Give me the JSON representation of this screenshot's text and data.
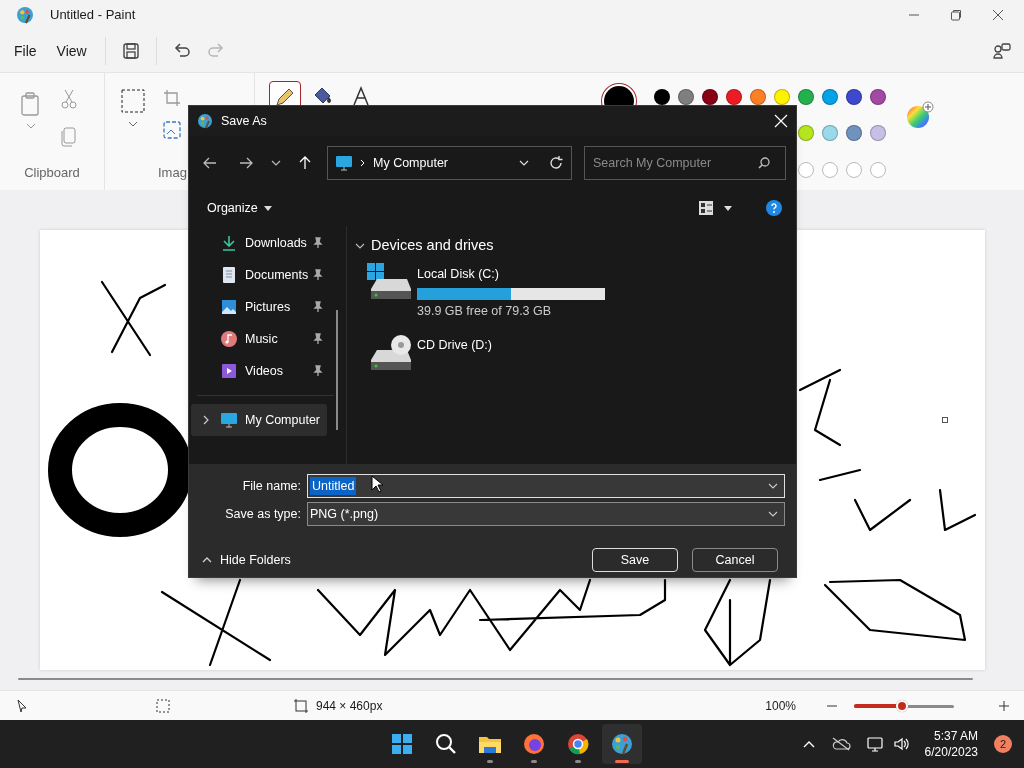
{
  "window": {
    "title": "Untitled - Paint"
  },
  "menu": [
    {
      "label": "File"
    },
    {
      "label": "View"
    }
  ],
  "quick_actions": [
    {
      "kind": "save",
      "disabled": false
    },
    {
      "kind": "undo",
      "disabled": false
    },
    {
      "kind": "redo",
      "disabled": true
    }
  ],
  "ribbon": {
    "groups": [
      {
        "label": "Clipboard"
      },
      {
        "label": "Imag"
      }
    ],
    "tools": [
      {
        "kind": "pencil",
        "selected": true
      },
      {
        "kind": "fill",
        "selected": false
      },
      {
        "kind": "text",
        "selected": false
      }
    ],
    "current_color": {
      "color": "#000000"
    },
    "palette_row_1": [
      {
        "color": "#000000"
      },
      {
        "color": "#7f7f7f"
      },
      {
        "color": "#880015"
      },
      {
        "color": "#ed1c24"
      },
      {
        "color": "#ff7f27"
      },
      {
        "color": "#fff200"
      },
      {
        "color": "#22b14c"
      },
      {
        "color": "#00a2e8"
      },
      {
        "color": "#3f48cc"
      },
      {
        "color": "#a349a4"
      }
    ],
    "palette_row_2": [
      {
        "color": "#b5e61d"
      },
      {
        "color": "#99d9ea"
      },
      {
        "color": "#7092be"
      },
      {
        "color": "#c8bfe7"
      }
    ]
  },
  "dialog": {
    "title": "Save As",
    "address": "My Computer",
    "search": {
      "placeholder": "Search My Computer"
    },
    "organize": "Organize",
    "nav_items": [
      {
        "label": "Downloads",
        "kind": "downloads",
        "pinned": true,
        "expandable": false,
        "selected": false
      },
      {
        "label": "Documents",
        "kind": "documents",
        "pinned": true,
        "expandable": false,
        "selected": false
      },
      {
        "label": "Pictures",
        "kind": "pictures",
        "pinned": true,
        "expandable": false,
        "selected": false
      },
      {
        "label": "Music",
        "kind": "music",
        "pinned": true,
        "expandable": false,
        "selected": false
      },
      {
        "label": "Videos",
        "kind": "videos",
        "pinned": true,
        "expandable": false,
        "selected": false
      },
      {
        "label": "My Computer",
        "kind": "computer",
        "pinned": false,
        "expandable": true,
        "selected": true
      }
    ],
    "section": {
      "title": "Devices and drives",
      "expanded": true
    },
    "drives": [
      {
        "name": "Local Disk (C:)",
        "kind": "disk",
        "level": 0.5,
        "reading": "39.9 GB free of 79.3 GB"
      },
      {
        "name": "CD Drive (D:)",
        "kind": "cd"
      }
    ],
    "file_name": {
      "label": "File name:",
      "value": "Untitled",
      "text_selected": true
    },
    "file_type": {
      "label": "Save as type:",
      "value": "PNG (*.png)"
    },
    "hide_folders": "Hide Folders",
    "buttons": [
      {
        "label": "Save",
        "default": true
      },
      {
        "label": "Cancel",
        "default": false
      }
    ]
  },
  "status_bar": {
    "canvas_size": "944 × 460px",
    "zoom": "100%",
    "zoom_slider": {
      "level": 0.48
    }
  },
  "taskbar": {
    "apps": [
      {
        "kind": "start",
        "running": false,
        "active": false
      },
      {
        "kind": "search",
        "running": false,
        "active": false
      },
      {
        "kind": "files",
        "running": true,
        "active": false
      },
      {
        "kind": "firefox",
        "running": true,
        "active": false
      },
      {
        "kind": "chrome",
        "running": true,
        "active": false
      },
      {
        "kind": "paint",
        "running": true,
        "active": true
      }
    ],
    "time": "5:37 AM",
    "date": "6/20/2023",
    "notifications": "2"
  }
}
